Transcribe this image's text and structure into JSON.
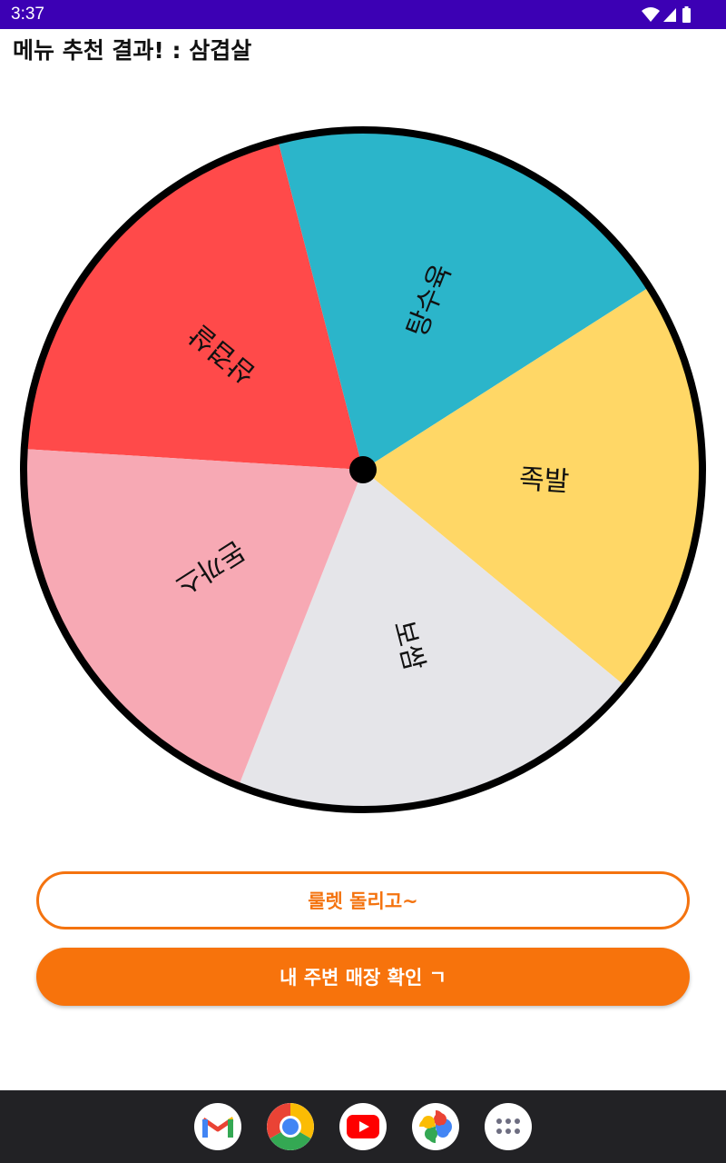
{
  "status_bar": {
    "time": "3:37"
  },
  "header": {
    "title": "메뉴 추천 결과! : 삼겹살"
  },
  "roulette": {
    "segments": [
      {
        "label": "삼겹살",
        "color": "#ff4a4a"
      },
      {
        "label": "탕수육",
        "color": "#2bb5ca"
      },
      {
        "label": "족발",
        "color": "#ffd766"
      },
      {
        "label": "보쌈",
        "color": "#e5e5e9"
      },
      {
        "label": "돈까스",
        "color": "#f7a9b4"
      }
    ],
    "rim_color": "#000000"
  },
  "buttons": {
    "spin_label": "룰렛 돌리고~",
    "nearby_label": "내 주변 매장 확인 ㄱ",
    "accent_color": "#f7730c"
  },
  "dock": {
    "apps": [
      "gmail-icon",
      "chrome-icon",
      "youtube-icon",
      "photos-icon",
      "app-drawer-icon"
    ]
  }
}
